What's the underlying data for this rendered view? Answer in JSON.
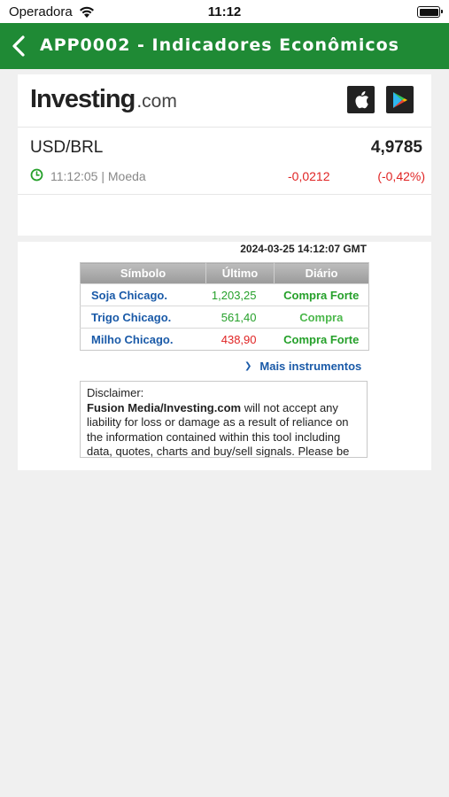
{
  "status_bar": {
    "carrier": "Operadora",
    "time": "11:12"
  },
  "nav": {
    "title": "APP0002 - Indicadores Econômicos"
  },
  "ticker_widget": {
    "logo_main": "Investing",
    "logo_suffix": ".com",
    "pair": "USD/BRL",
    "price": "4,9785",
    "time": "11:12:05 | Moeda",
    "change": "-0,0212",
    "change_pct": "(-0,42%)"
  },
  "quotes_widget": {
    "timestamp": "2024-03-25 14:12:07 GMT",
    "columns": [
      "Símbolo",
      "Último",
      "Diário"
    ],
    "rows": [
      {
        "symbol": "Soja Chicago.",
        "last": "1,203,25",
        "signal": "Compra Forte",
        "last_color": "#25a02a",
        "signal_color": "#25a02a"
      },
      {
        "symbol": "Trigo Chicago.",
        "last": "561,40",
        "signal": "Compra",
        "last_color": "#25a02a",
        "signal_color": "#4cb84c"
      },
      {
        "symbol": "Milho Chicago.",
        "last": "438,90",
        "signal": "Compra Forte",
        "last_color": "#e02424",
        "signal_color": "#25a02a"
      }
    ],
    "more_link": "Mais instrumentos",
    "disclaimer_title": "Disclaimer",
    "disclaimer_brand": "Fusion Media/Investing.com",
    "disclaimer_text": " will not accept any liability for loss or damage as a result of reliance on the information contained within this tool including data, quotes, charts and buy/sell signals. Please be"
  },
  "colors": {
    "nav_green": "#1f8a35",
    "positive": "#25a02a",
    "negative": "#e02424",
    "link_blue": "#1a5aa8"
  }
}
